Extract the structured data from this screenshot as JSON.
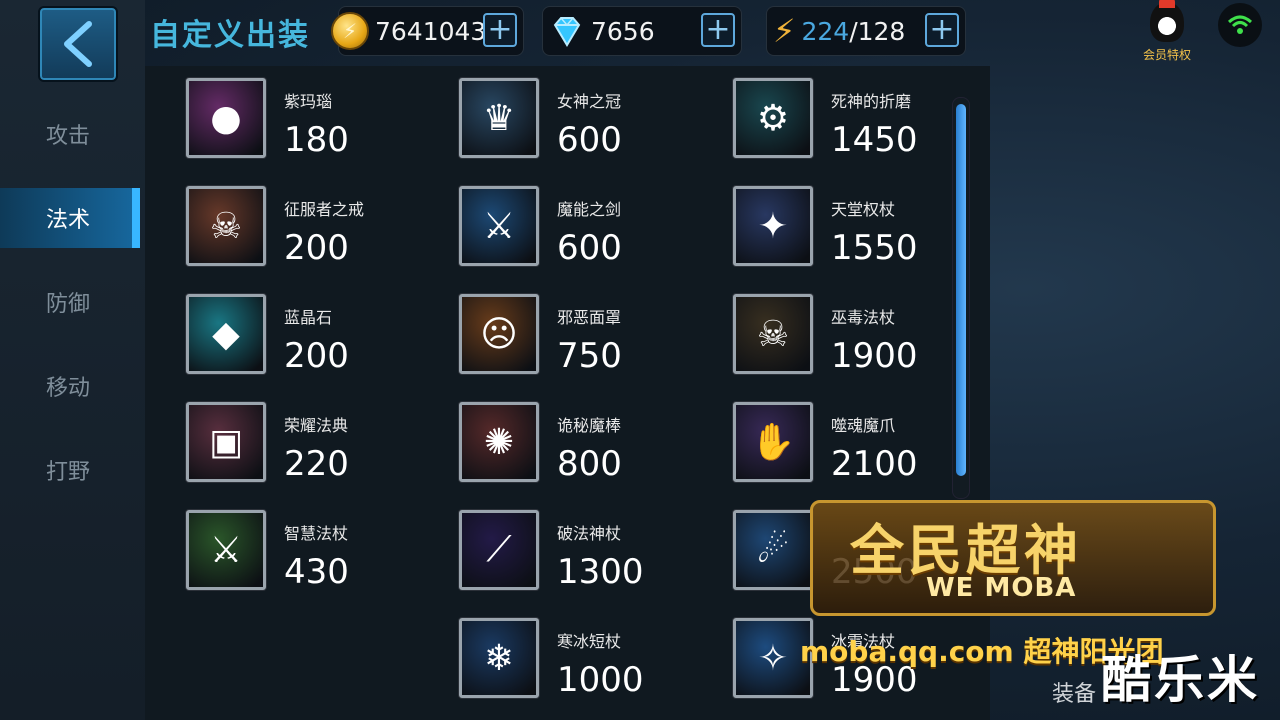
{
  "header": {
    "title": "自定义出装",
    "gold": "7641043",
    "diamond": "7656",
    "energy_current": "224",
    "energy_max": "/128",
    "vip_label": "会员特权"
  },
  "sidebar": {
    "items": [
      {
        "label": "攻击"
      },
      {
        "label": "法术"
      },
      {
        "label": "防御"
      },
      {
        "label": "移动"
      },
      {
        "label": "打野"
      }
    ],
    "active_index": 1
  },
  "items": [
    {
      "name": "紫玛瑙",
      "price": "180",
      "color": "#6a2c6b",
      "glyph": "●"
    },
    {
      "name": "征服者之戒",
      "price": "200",
      "color": "#6d3b2a",
      "glyph": "☠"
    },
    {
      "name": "蓝晶石",
      "price": "200",
      "color": "#1a7d8a",
      "glyph": "◆"
    },
    {
      "name": "荣耀法典",
      "price": "220",
      "color": "#5d3040",
      "glyph": "▣"
    },
    {
      "name": "智慧法杖",
      "price": "430",
      "color": "#2c5a2a",
      "glyph": "⚔"
    },
    {
      "name": "女神之冠",
      "price": "600",
      "color": "#2a4a66",
      "glyph": "♛"
    },
    {
      "name": "魔能之剑",
      "price": "600",
      "color": "#1d4c7a",
      "glyph": "⚔"
    },
    {
      "name": "邪恶面罩",
      "price": "750",
      "color": "#6e3e1a",
      "glyph": "☹"
    },
    {
      "name": "诡秘魔棒",
      "price": "800",
      "color": "#5a2a2a",
      "glyph": "✺"
    },
    {
      "name": "破法神杖",
      "price": "1300",
      "color": "#241a4a",
      "glyph": "⟋"
    },
    {
      "name": "寒冰短杖",
      "price": "1000",
      "color": "#1b3c66",
      "glyph": "❄"
    },
    {
      "name": "死神的折磨",
      "price": "1450",
      "color": "#1a4a52",
      "glyph": "⚙"
    },
    {
      "name": "天堂权杖",
      "price": "1550",
      "color": "#2a3a66",
      "glyph": "✦"
    },
    {
      "name": "巫毒法杖",
      "price": "1900",
      "color": "#3a3020",
      "glyph": "☠"
    },
    {
      "name": "噬魂魔爪",
      "price": "2100",
      "color": "#3a2a5a",
      "glyph": "✋"
    },
    {
      "name": "",
      "price": "2500",
      "color": "#1f4a7a",
      "glyph": "☄"
    },
    {
      "name": "冰霜法杖",
      "price": "1900",
      "color": "#1e4f86",
      "glyph": "✧"
    }
  ],
  "watermark": {
    "logo_text": "全民超神",
    "logo_sub": "WE MOBA",
    "site": "moba.qq.com 超神阳光团",
    "corner": "酷乐米"
  },
  "footer": {
    "equip_label": "装备"
  }
}
